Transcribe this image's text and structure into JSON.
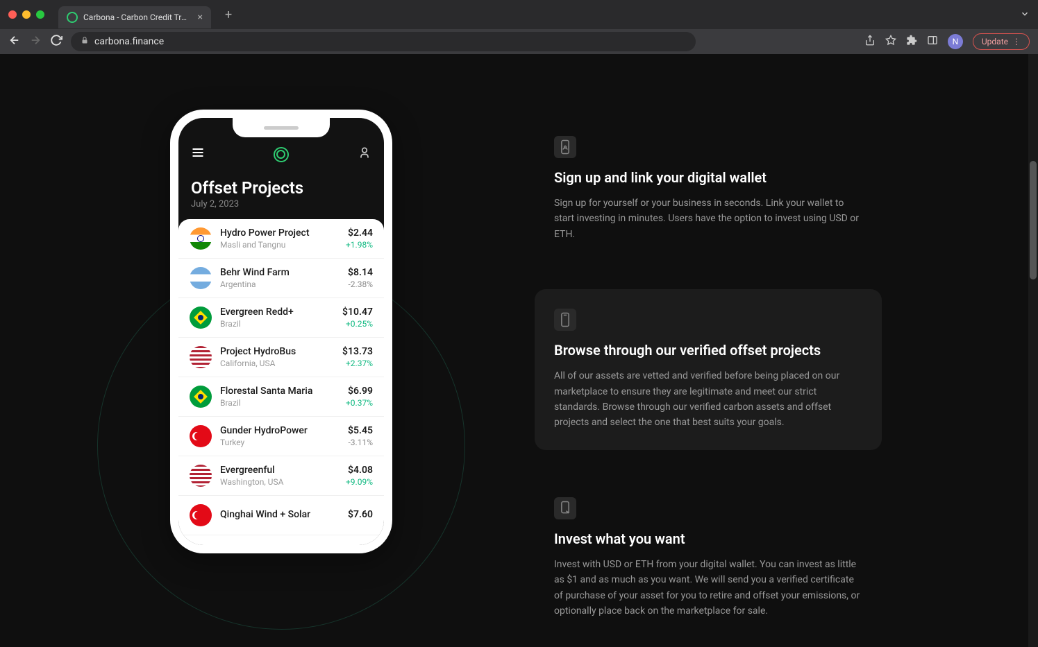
{
  "browser": {
    "tab_title": "Carbona - Carbon Credit Tradin",
    "url": "carbona.finance",
    "profile_initial": "N",
    "update_label": "Update"
  },
  "phone": {
    "page_title": "Offset Projects",
    "page_date": "July 2, 2023",
    "projects": [
      {
        "name": "Hydro Power Project",
        "location": "Masli and Tangnu",
        "price": "$2.44",
        "change": "+1.98%",
        "dir": "pos",
        "flag": "flag-india"
      },
      {
        "name": "Behr Wind Farm",
        "location": "Argentina",
        "price": "$8.14",
        "change": "-2.38%",
        "dir": "neg",
        "flag": "flag-argentina"
      },
      {
        "name": "Evergreen Redd+",
        "location": "Brazil",
        "price": "$10.47",
        "change": "+0.25%",
        "dir": "pos",
        "flag": "flag-brazil"
      },
      {
        "name": "Project HydroBus",
        "location": "California, USA",
        "price": "$13.73",
        "change": "+2.37%",
        "dir": "pos",
        "flag": "flag-usa"
      },
      {
        "name": "Florestal Santa Maria",
        "location": "Brazil",
        "price": "$6.99",
        "change": "+0.37%",
        "dir": "pos",
        "flag": "flag-brazil"
      },
      {
        "name": "Gunder HydroPower",
        "location": "Turkey",
        "price": "$5.45",
        "change": "-3.11%",
        "dir": "neg",
        "flag": "flag-turkey"
      },
      {
        "name": "Evergreenful",
        "location": "Washington, USA",
        "price": "$4.08",
        "change": "+9.09%",
        "dir": "pos",
        "flag": "flag-usa"
      },
      {
        "name": "Qinghai Wind + Solar",
        "location": "",
        "price": "$7.60",
        "change": "",
        "dir": "pos",
        "flag": "flag-turkey"
      }
    ]
  },
  "features": [
    {
      "icon": "phone-user-icon",
      "title": "Sign up and link your digital wallet",
      "desc": "Sign up for yourself or your business in seconds. Link your wallet to start investing in minutes. Users have the option to invest using USD or ETH.",
      "active": false
    },
    {
      "icon": "document-icon",
      "title": "Browse through our verified offset projects",
      "desc": "All of our assets are vetted and verified before being placed on our marketplace to ensure they are legitimate and meet our strict standards. Browse through our verified carbon assets and offset projects and select the one that best suits your goals.",
      "active": true
    },
    {
      "icon": "phone-tap-icon",
      "title": "Invest what you want",
      "desc": "Invest with USD or ETH from your digital wallet. You can invest as little as $1 and as much as you want. We will send you a verified certificate of purchase of your asset for you to retire and offset your emissions, or optionally place back on the marketplace for sale.",
      "active": false
    }
  ]
}
